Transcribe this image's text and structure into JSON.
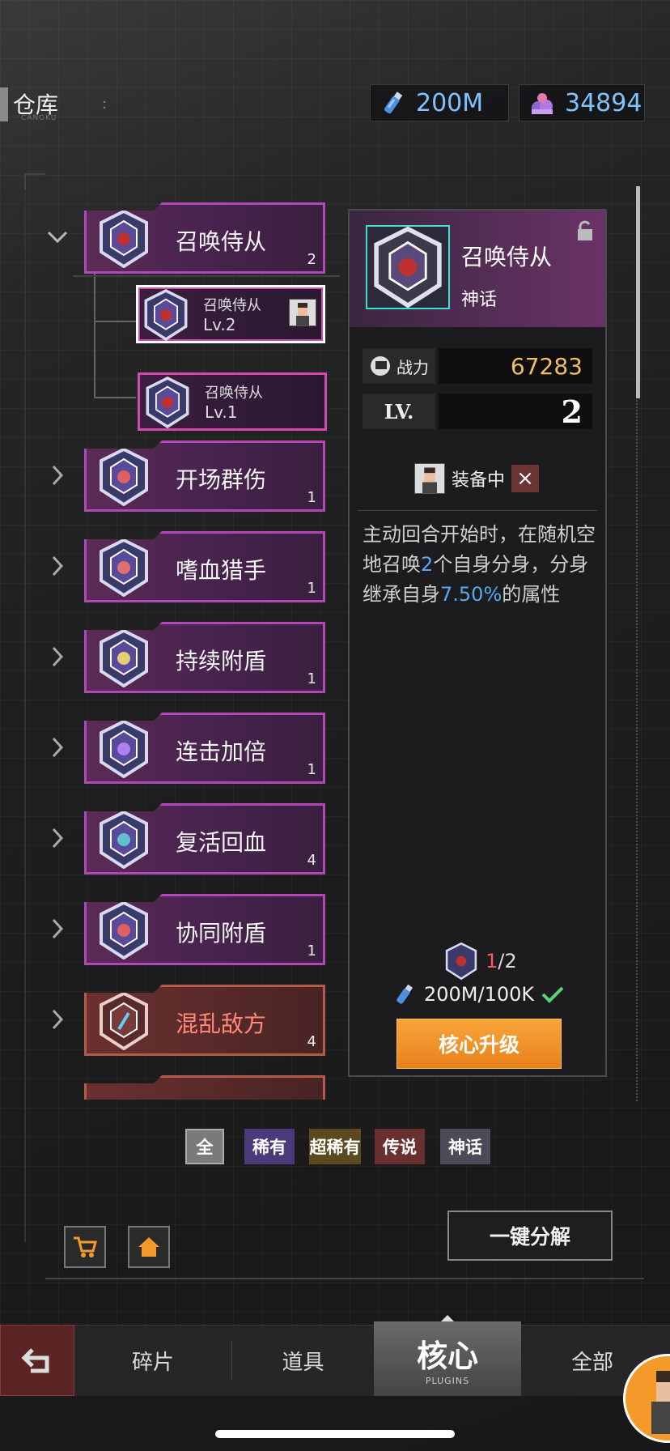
{
  "header": {
    "title": "仓库",
    "subtitle": "CANGKU",
    "title_dots": ":",
    "resource_bottle": "200M",
    "resource_gems": "34894"
  },
  "cores": [
    {
      "name": "召唤侍从",
      "count": "2",
      "expanded": true,
      "rarity_color": "#b049b7"
    },
    {
      "name": "开场群伤",
      "count": "1"
    },
    {
      "name": "嗜血猎手",
      "count": "1"
    },
    {
      "name": "持续附盾",
      "count": "1"
    },
    {
      "name": "连击加倍",
      "count": "1"
    },
    {
      "name": "复活回血",
      "count": "4"
    },
    {
      "name": "协同附盾",
      "count": "1"
    },
    {
      "name": "混乱敌方",
      "count": "4",
      "rarity_color": "#b35a4a"
    }
  ],
  "sub_items": [
    {
      "name": "召唤侍从",
      "level": "Lv.2",
      "selected": true
    },
    {
      "name": "召唤侍从",
      "level": "Lv.1",
      "selected": false
    }
  ],
  "detail": {
    "name": "召唤侍从",
    "rarity": "神话",
    "power_label": "战力",
    "power_value": "67283",
    "lv_label": "LV.",
    "lv_value": "2",
    "equipped_label": "装备中",
    "desc_1": "主动回合开始时，在随机空地召唤",
    "desc_num1": "2",
    "desc_2": "个自身分身，分身继承自身",
    "desc_num2": "7.50%",
    "desc_3": "的属性",
    "fragments_have": "1",
    "fragments_need": "/2",
    "cost": "200M/100K",
    "upgrade_button": "核心升级"
  },
  "filters": [
    {
      "label": "全",
      "color": "#7a7a7a"
    },
    {
      "label": "稀有",
      "color": "#4a3a7a"
    },
    {
      "label": "超稀有",
      "color": "#5a4a1e"
    },
    {
      "label": "传说",
      "color": "#6a3030"
    },
    {
      "label": "神话",
      "color": "#4a4a58"
    }
  ],
  "decompose_button": "一键分解",
  "nav": {
    "tab_fragments": "碎片",
    "tab_items": "道具",
    "tab_core": "核心",
    "tab_core_sub": "PLUGINS",
    "tab_all": "全部"
  },
  "colors": {
    "accent_blue": "#7ec3ff",
    "power_gold": "#f0c060",
    "upgrade_orange": "#f39a2a"
  }
}
